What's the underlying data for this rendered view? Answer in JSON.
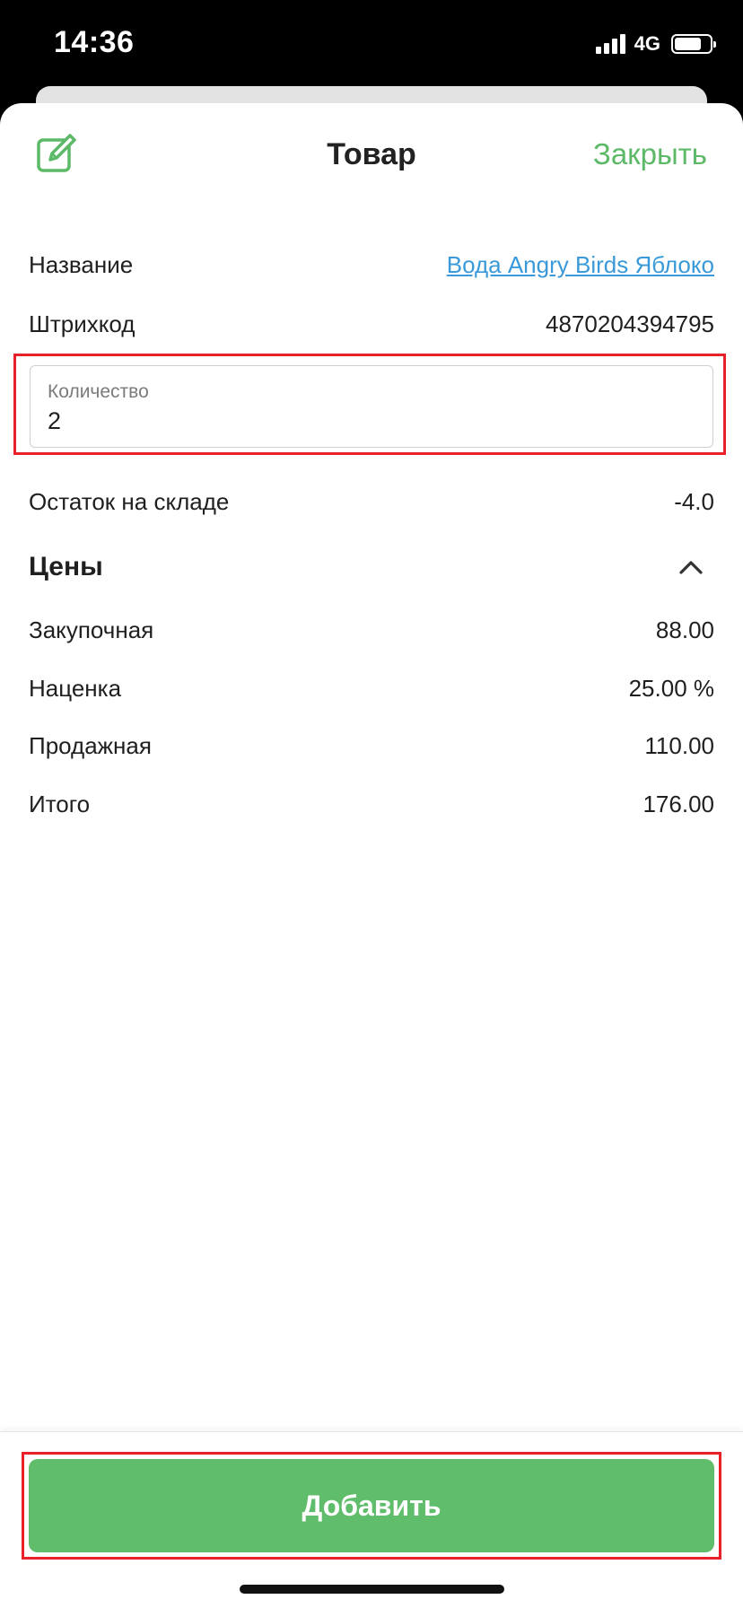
{
  "status_bar": {
    "time": "14:36",
    "network": "4G",
    "battery_level": 0.75
  },
  "header": {
    "title": "Товар",
    "close_label": "Закрыть",
    "edit_icon": "edit-icon"
  },
  "product": {
    "name_label": "Название",
    "name_value": "Вода Angry Birds Яблоко",
    "barcode_label": "Штрихкод",
    "barcode_value": "4870204394795",
    "quantity_label": "Количество",
    "quantity_value": "2",
    "stock_label": "Остаток на складе",
    "stock_value": "-4.0"
  },
  "prices": {
    "section_title": "Цены",
    "chevron_icon": "chevron-up-icon",
    "items": [
      {
        "label": "Закупочная",
        "value": "88.00"
      },
      {
        "label": "Наценка",
        "value": "25.00 %"
      },
      {
        "label": "Продажная",
        "value": "110.00"
      },
      {
        "label": "Итого",
        "value": "176.00"
      }
    ]
  },
  "footer": {
    "add_label": "Добавить"
  },
  "colors": {
    "accent": "#5fbd6b",
    "link": "#3a9ad9",
    "highlight": "#e8202a"
  }
}
